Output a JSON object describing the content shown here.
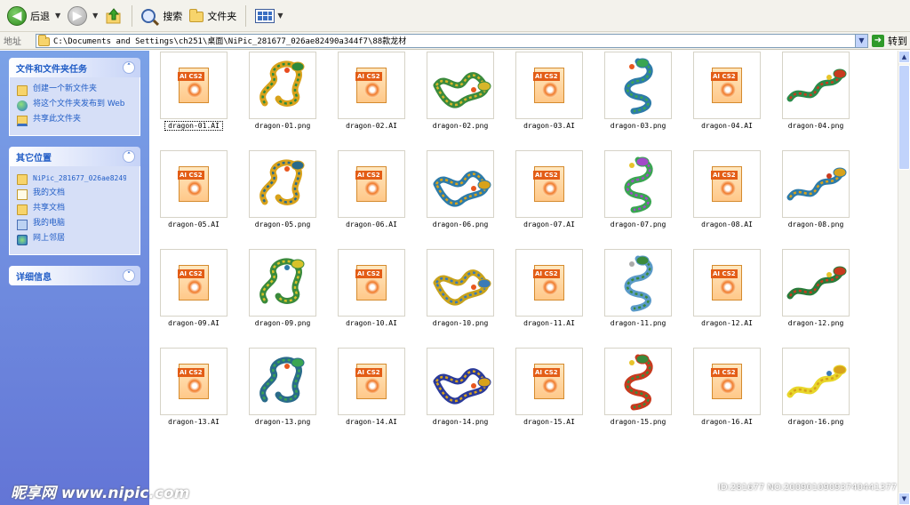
{
  "toolbar": {
    "back_label": "后退",
    "search_label": "搜索",
    "folders_label": "文件夹"
  },
  "address": {
    "label": "地址",
    "path": "C:\\Documents and Settings\\ch251\\桌面\\NiPic_281677_026ae82490a344f7\\88款龙材",
    "go_label": "转到"
  },
  "sidebar": {
    "file_tasks": {
      "title": "文件和文件夹任务",
      "items": [
        {
          "label": "创建一个新文件夹",
          "icon": "new-folder-icon"
        },
        {
          "label": "将这个文件夹发布到 Web",
          "icon": "publish-web-icon"
        },
        {
          "label": "共享此文件夹",
          "icon": "share-folder-icon"
        }
      ]
    },
    "other_places": {
      "title": "其它位置",
      "items": [
        {
          "label": "NiPic_281677_026ae8249",
          "icon": "folder-icon"
        },
        {
          "label": "我的文档",
          "icon": "my-documents-icon"
        },
        {
          "label": "共享文档",
          "icon": "shared-documents-icon"
        },
        {
          "label": "我的电脑",
          "icon": "my-computer-icon"
        },
        {
          "label": "网上邻居",
          "icon": "network-places-icon"
        }
      ]
    },
    "details": {
      "title": "详细信息"
    }
  },
  "files": [
    "dragon-01.AI",
    "dragon-01.png",
    "dragon-02.AI",
    "dragon-02.png",
    "dragon-03.AI",
    "dragon-03.png",
    "dragon-04.AI",
    "dragon-04.png",
    "dragon-05.AI",
    "dragon-05.png",
    "dragon-06.AI",
    "dragon-06.png",
    "dragon-07.AI",
    "dragon-07.png",
    "dragon-08.AI",
    "dragon-08.png",
    "dragon-09.AI",
    "dragon-09.png",
    "dragon-10.AI",
    "dragon-10.png",
    "dragon-11.AI",
    "dragon-11.png",
    "dragon-12.AI",
    "dragon-12.png",
    "dragon-13.AI",
    "dragon-13.png",
    "dragon-14.AI",
    "dragon-14.png",
    "dragon-15.AI",
    "dragon-15.png",
    "dragon-16.AI",
    "dragon-16.png"
  ],
  "ai_badge": "AI CS2",
  "watermark": {
    "left": "昵享网 www.nipic.com",
    "right": "ID:281677 NO:20090109093740441377"
  },
  "colors": {
    "sidebar_top": "#7ba2e7",
    "sidebar_bottom": "#6375d6",
    "task_link": "#215dc6"
  }
}
